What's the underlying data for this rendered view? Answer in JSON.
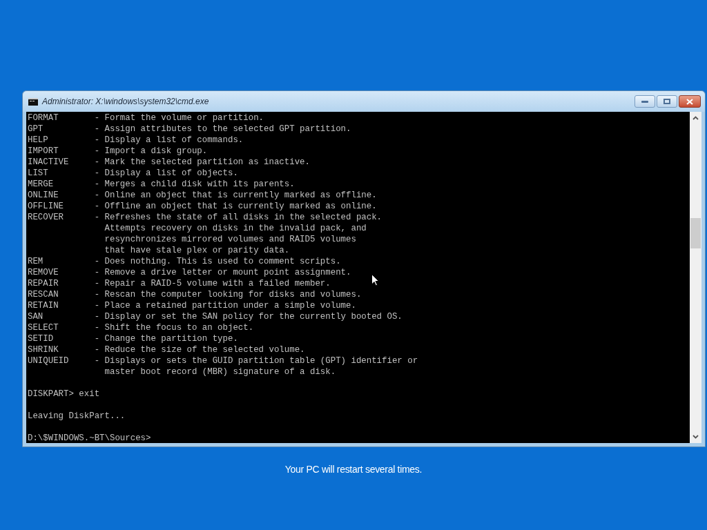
{
  "window": {
    "title": "Administrator: X:\\windows\\system32\\cmd.exe"
  },
  "console": {
    "blocks": [
      [
        "FORMAT       - Format the volume or partition.",
        "GPT          - Assign attributes to the selected GPT partition.",
        "HELP         - Display a list of commands.",
        "IMPORT       - Import a disk group.",
        "INACTIVE     - Mark the selected partition as inactive.",
        "LIST         - Display a list of objects.",
        "MERGE        - Merges a child disk with its parents.",
        "ONLINE       - Online an object that is currently marked as offline.",
        "OFFLINE      - Offline an object that is currently marked as online.",
        "RECOVER      - Refreshes the state of all disks in the selected pack.",
        "               Attempts recovery on disks in the invalid pack, and",
        "               resynchronizes mirrored volumes and RAID5 volumes",
        "               that have stale plex or parity data.",
        "REM          - Does nothing. This is used to comment scripts.",
        "REMOVE       - Remove a drive letter or mount point assignment.",
        "REPAIR       - Repair a RAID-5 volume with a failed member.",
        "RESCAN       - Rescan the computer looking for disks and volumes.",
        "RETAIN       - Place a retained partition under a simple volume.",
        "SAN          - Display or set the SAN policy for the currently booted OS.",
        "SELECT       - Shift the focus to an object.",
        "SETID        - Change the partition type.",
        "SHRINK       - Reduce the size of the selected volume.",
        "UNIQUEID     - Displays or sets the GUID partition table (GPT) identifier or",
        "               master boot record (MBR) signature of a disk."
      ],
      [
        "DISKPART> exit"
      ],
      [
        "Leaving DiskPart..."
      ],
      [
        "D:\\$WINDOWS.~BT\\Sources>"
      ]
    ]
  },
  "status_message": "Your PC will restart several times."
}
